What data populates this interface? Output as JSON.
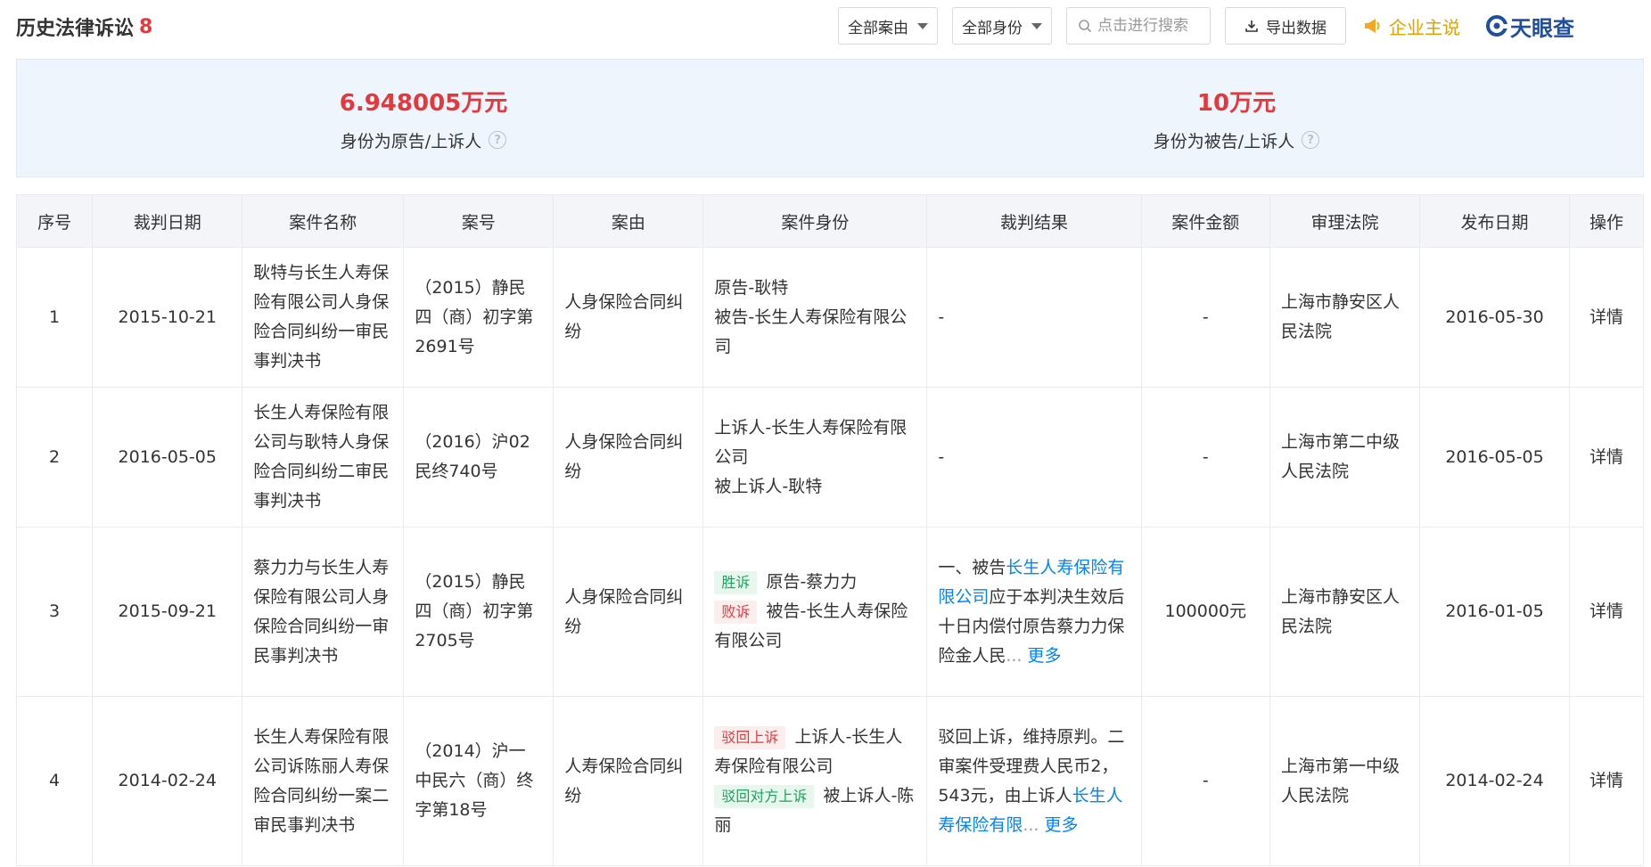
{
  "header": {
    "title": "历史法律诉讼",
    "count": "8"
  },
  "toolbar": {
    "cause_filter": "全部案由",
    "role_filter": "全部身份",
    "search_placeholder": "点击进行搜索",
    "export_label": "导出数据",
    "enterprise_label": "企业主说",
    "logo_text": "天眼查"
  },
  "summary": {
    "plaintiff_amount": "6.948005万元",
    "plaintiff_label": "身份为原告/上诉人",
    "defendant_amount": "10万元",
    "defendant_label": "身份为被告/上诉人"
  },
  "table": {
    "columns": [
      "序号",
      "裁判日期",
      "案件名称",
      "案号",
      "案由",
      "案件身份",
      "裁判结果",
      "案件金额",
      "审理法院",
      "发布日期",
      "操作"
    ],
    "rows": [
      {
        "no": "1",
        "date": "2015-10-21",
        "name": "耿特与长生人寿保险有限公司人身保险合同纠纷一审民事判决书",
        "case_no": "（2015）静民四（商）初字第2691号",
        "cause": "人身保险合同纠纷",
        "role_line1": "原告-耿特",
        "role_line2": "被告-长生人寿保险有限公司",
        "result": "-",
        "amount": "-",
        "court": "上海市静安区人民法院",
        "publish": "2016-05-30",
        "action": "详情"
      },
      {
        "no": "2",
        "date": "2016-05-05",
        "name": "长生人寿保险有限公司与耿特人身保险合同纠纷二审民事判决书",
        "case_no": "（2016）沪02民终740号",
        "cause": "人身保险合同纠纷",
        "role_line1": "上诉人-长生人寿保险有限公司",
        "role_line2": "被上诉人-耿特",
        "result": "-",
        "amount": "-",
        "court": "上海市第二中级人民法院",
        "publish": "2016-05-05",
        "action": "详情"
      },
      {
        "no": "3",
        "date": "2015-09-21",
        "name": "蔡力力与长生人寿保险有限公司人身保险合同纠纷一审民事判决书",
        "case_no": "（2015）静民四（商）初字第2705号",
        "cause": "人身保险合同纠纷",
        "tag1": "胜诉",
        "role_line1": "原告-蔡力力",
        "tag2": "败诉",
        "role_line2": "被告-长生人寿保险有限公司",
        "result_pre": "一、被告",
        "result_link": "长生人寿保险有限公司",
        "result_post": "应于本判决生效后十日内偿付原告蔡力力保险金人民",
        "ellipsis": "...",
        "more": "更多",
        "amount": "100000元",
        "court": "上海市静安区人民法院",
        "publish": "2016-01-05",
        "action": "详情"
      },
      {
        "no": "4",
        "date": "2014-02-24",
        "name": "长生人寿保险有限公司诉陈丽人寿保险合同纠纷一案二审民事判决书",
        "case_no": "（2014）沪一中民六（商）终字第18号",
        "cause": "人寿保险合同纠纷",
        "tag1": "驳回上诉",
        "role_line1": "上诉人-长生人寿保险有限公司",
        "tag2": "驳回对方上诉",
        "role_line2": "被上诉人-陈丽",
        "result_pre": "驳回上诉，维持原判。二审案件受理费人民币2，543元，由上诉人",
        "result_link": "长生人寿保险有限",
        "ellipsis": "...",
        "more": "更多",
        "amount": "-",
        "court": "上海市第一中级人民法院",
        "publish": "2014-02-24",
        "action": "详情"
      }
    ]
  },
  "colors": {
    "accent_red": "#e4393c",
    "link_blue": "#0084ff",
    "summary_bg": "#eef5fd",
    "header_bg": "#f3f5f9",
    "tag_green": "#1ba25e",
    "enterprise_orange": "#e8a000"
  },
  "icons": [
    "caret-down-icon",
    "search-icon",
    "download-icon",
    "megaphone-icon",
    "tianyancha-logo-icon",
    "question-icon"
  ]
}
